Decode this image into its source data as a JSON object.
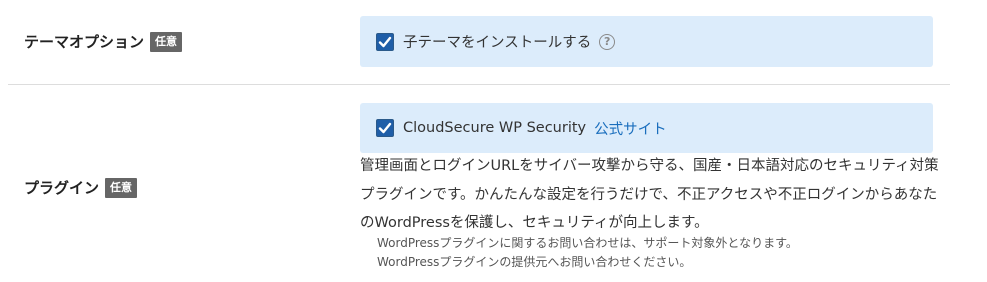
{
  "theme_option": {
    "label": "テーマオプション",
    "badge": "任意",
    "checkbox_label": "子テーマをインストールする",
    "checked": true,
    "help_icon": "question-circle-icon",
    "help_text": "?"
  },
  "plugin": {
    "label": "プラグイン",
    "badge": "任意",
    "checkbox_label": "CloudSecure WP Security",
    "checked": true,
    "link_text": "公式サイト",
    "description": "管理画面とログインURLをサイバー攻撃から守る、国産・日本語対応のセキュリティ対策プラグインです。かんたんな設定を行うだけで、不正アクセスや不正ログインからあなたのWordPressを保護し、セキュリティが向上します。",
    "notes": [
      "WordPressプラグインに関するお問い合わせは、サポート対象外となります。",
      "WordPressプラグインの提供元へお問い合わせください。"
    ]
  },
  "colors": {
    "option_bg": "#dcecfb",
    "checkbox": "#1f5ea8",
    "link": "#1a6ebd",
    "badge_bg": "#666666"
  }
}
